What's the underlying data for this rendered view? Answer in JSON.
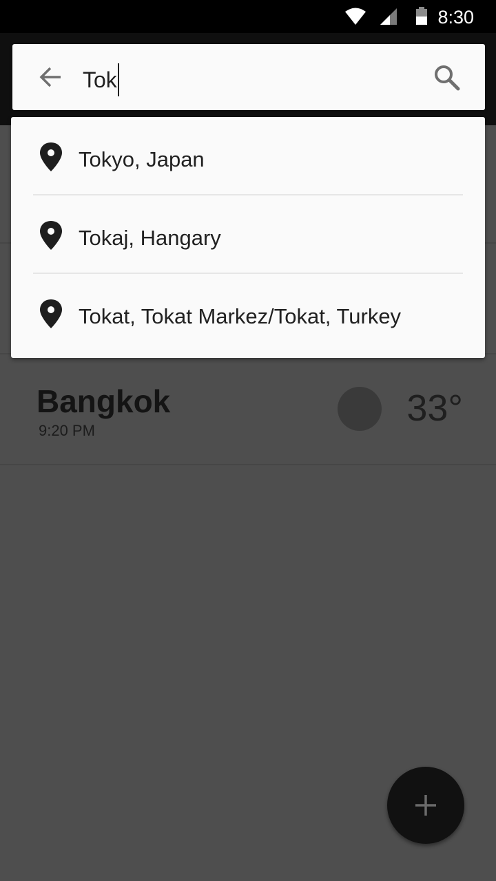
{
  "status_bar": {
    "time": "8:30",
    "icons": [
      "wifi-icon",
      "cell-signal-icon",
      "battery-icon"
    ]
  },
  "search": {
    "value": "Tok",
    "back_icon": "arrow-back-icon",
    "search_icon": "search-icon"
  },
  "suggestions": [
    {
      "label": "Tokyo, Japan",
      "icon": "location-pin-icon"
    },
    {
      "label": "Tokaj, Hangary",
      "icon": "location-pin-icon"
    },
    {
      "label": "Tokat, Tokat Markez/Tokat, Turkey",
      "icon": "location-pin-icon"
    }
  ],
  "city_card": {
    "name": "Bangkok",
    "time": "9:20 PM",
    "temperature": "33°"
  },
  "fab": {
    "icon": "plus-icon"
  },
  "colors": {
    "status_bar": "#000000",
    "toolbar": "#0f0f0f",
    "scrim_background": "#4e4e4e",
    "card_surface": "#fafafa",
    "fab": "#111111"
  }
}
